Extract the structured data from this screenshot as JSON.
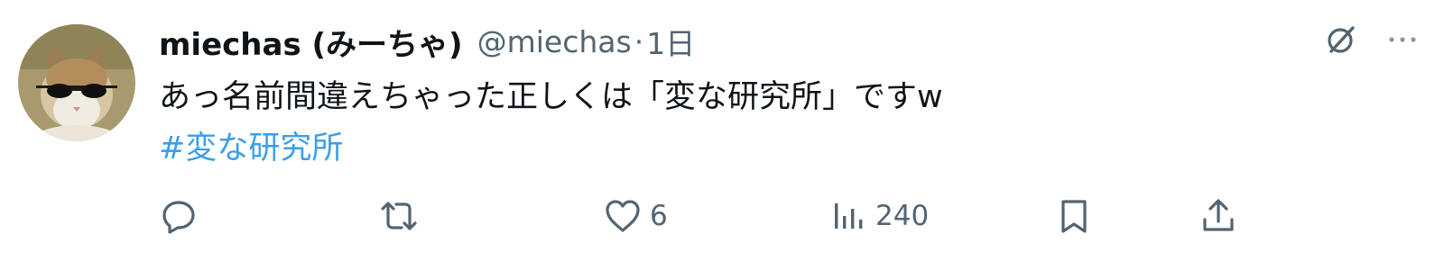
{
  "tweet": {
    "display_name": "miechas (みーちゃ)",
    "handle": "@miechas",
    "separator": "·",
    "time": "1日",
    "text": "あっ名前間違えちゃった正しくは「変な研究所」ですw",
    "hashtag": "#変な研究所"
  },
  "top_icons": [
    "grok-icon",
    "more-icon"
  ],
  "actions": {
    "reply": {
      "icon": "reply-icon",
      "count": ""
    },
    "retweet": {
      "icon": "retweet-icon",
      "count": ""
    },
    "like": {
      "icon": "heart-icon",
      "count": "6"
    },
    "views": {
      "icon": "views-icon",
      "count": "240"
    },
    "bookmark": {
      "icon": "bookmark-icon",
      "count": ""
    },
    "share": {
      "icon": "share-icon",
      "count": ""
    }
  },
  "colors": {
    "text": "#0f1419",
    "secondary": "#536471",
    "hashtag": "#3d9ee8",
    "background": "#ffffff"
  }
}
